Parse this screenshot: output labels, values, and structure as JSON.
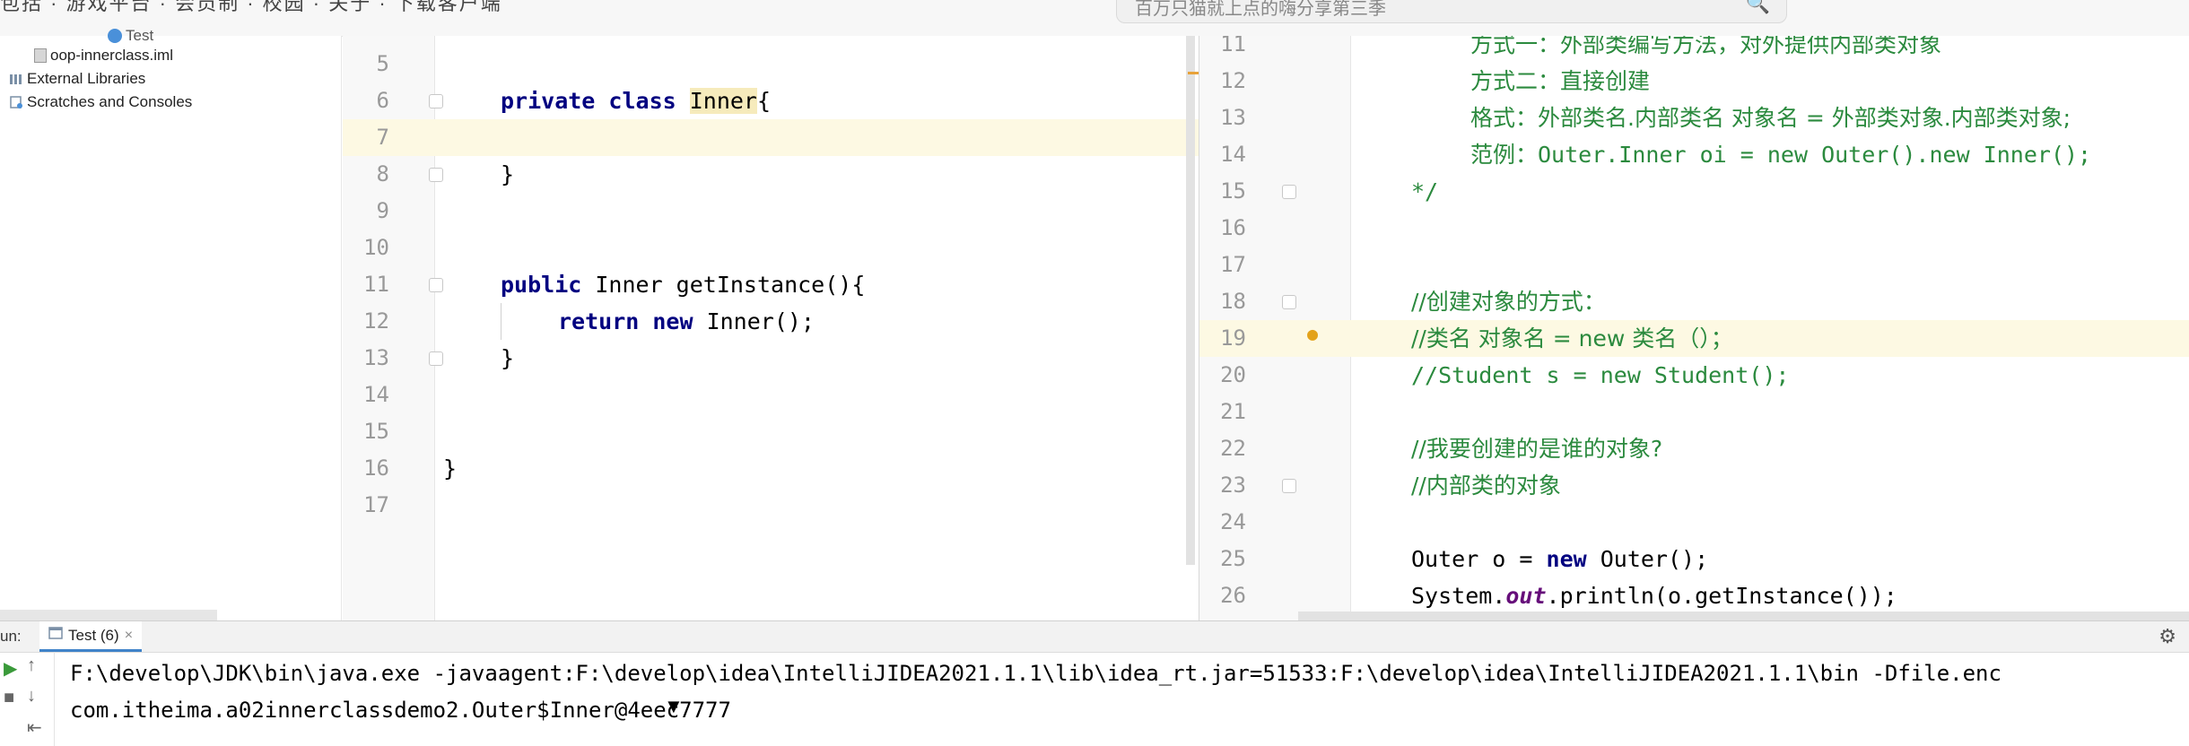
{
  "top_overlay": {
    "menu_text": "包括 · 游戏平台 · 会员制 · 校园 · 关于 · 下载客户端",
    "search_text": "百万只猫就上点的嗨分享第三季",
    "search_icon": "search-icon"
  },
  "project_tree": {
    "items": [
      {
        "label": "Test",
        "icon": "java-class-icon"
      },
      {
        "label": "oop-innerclass.iml",
        "icon": "module-file-icon"
      },
      {
        "label": "External Libraries",
        "icon": "libraries-icon"
      },
      {
        "label": "Scratches and Consoles",
        "icon": "scratches-icon"
      }
    ]
  },
  "editor_left": {
    "lines": [
      {
        "num": "5",
        "code": ""
      },
      {
        "num": "6",
        "pre": "private class ",
        "highlight": "Inner",
        "post": "{"
      },
      {
        "num": "7",
        "code": ""
      },
      {
        "num": "8",
        "code": "}"
      },
      {
        "num": "9",
        "code": ""
      },
      {
        "num": "10",
        "code": ""
      },
      {
        "num": "11",
        "kw": "public",
        "rest": " Inner getInstance(){"
      },
      {
        "num": "12",
        "kw": "return new",
        "rest": " Inner();"
      },
      {
        "num": "13",
        "code": "}"
      },
      {
        "num": "14",
        "code": ""
      },
      {
        "num": "15",
        "code": ""
      },
      {
        "num": "16",
        "code": "}"
      },
      {
        "num": "17",
        "code": ""
      }
    ]
  },
  "editor_right": {
    "lines": [
      {
        "num": "11",
        "comment": "方式一：外部类编写方法，对外提供内部类对象"
      },
      {
        "num": "12",
        "comment": "方式二：直接创建"
      },
      {
        "num": "13",
        "comment": "格式：外部类名.内部类名 对象名 = 外部类对象.内部类对象;"
      },
      {
        "num": "14",
        "comment": "范例：Outer.Inner oi = new Outer().new Inner();"
      },
      {
        "num": "15",
        "comment": "*/"
      },
      {
        "num": "16",
        "comment": ""
      },
      {
        "num": "17",
        "comment": ""
      },
      {
        "num": "18",
        "comment": "//创建对象的方式："
      },
      {
        "num": "19",
        "comment": "//类名 对象名 = new 类名（）；"
      },
      {
        "num": "20",
        "comment": "//Student s = new Student();"
      },
      {
        "num": "21",
        "comment": ""
      },
      {
        "num": "22",
        "comment": "//我要创建的是谁的对象?"
      },
      {
        "num": "23",
        "comment": "//内部类的对象"
      },
      {
        "num": "24",
        "comment": ""
      },
      {
        "num": "25",
        "c1": "Outer o = ",
        "kw": "new",
        "c2": " Outer();"
      },
      {
        "num": "26",
        "c1": "System.",
        "field": "out",
        "c2": ".println(o.getInstance());"
      }
    ]
  },
  "run_panel": {
    "label": "un:",
    "tab_label": "Test (6)",
    "tab_close": "×",
    "console_lines": [
      "F:\\develop\\JDK\\bin\\java.exe -javaagent:F:\\develop\\idea\\IntelliJIDEA2021.1.1\\lib\\idea_rt.jar=51533:F:\\develop\\idea\\IntelliJIDEA2021.1.1\\bin -Dfile.enc",
      "com.itheima.a02innerclassdemo2.Outer$Inner@4eec7777"
    ]
  },
  "colors": {
    "keyword": "#000080",
    "comment": "#2b8a3e",
    "current_line": "#fdf9e3",
    "highlight": "#f6ebbc"
  }
}
